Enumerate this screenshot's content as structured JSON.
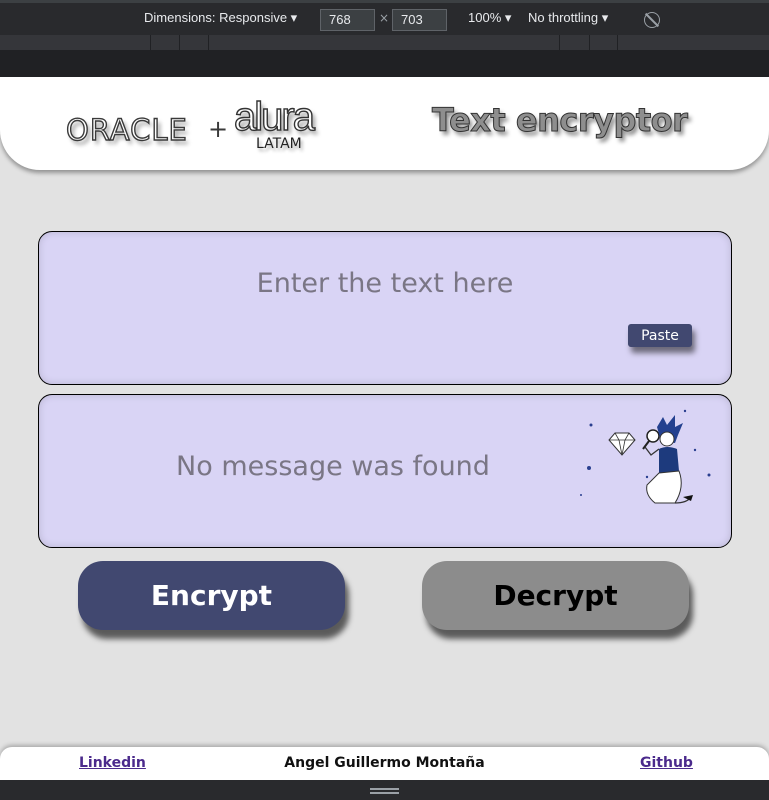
{
  "devtools": {
    "dimensions_label": "Dimensions: Responsive ▾",
    "width_value": "768",
    "times": "×",
    "height_value": "703",
    "zoom": "100% ▾",
    "throttling": "No throttling ▾",
    "rotate_icon": "rotate-icon"
  },
  "header": {
    "logo_oracle": "ORACLE",
    "logo_plus": "+",
    "logo_alura": "alura",
    "logo_latam": "LATAM",
    "title": "Text encryptor"
  },
  "input": {
    "placeholder": "Enter the text here",
    "value": "",
    "paste_label": "Paste"
  },
  "output": {
    "message": "No message was found",
    "illustration": "person-with-magnifier-diamond-illustration"
  },
  "actions": {
    "encrypt_label": "Encrypt",
    "decrypt_label": "Decrypt"
  },
  "footer": {
    "linkedin": "Linkedin",
    "author": "Angel Guillermo Montaña",
    "github": "Github"
  },
  "colors": {
    "page_bg": "#e2e2e2",
    "panel_bg": "#d9d4f5",
    "encrypt_bg": "#414870",
    "decrypt_bg": "#8c8c8c",
    "link": "#4b2a8c"
  }
}
